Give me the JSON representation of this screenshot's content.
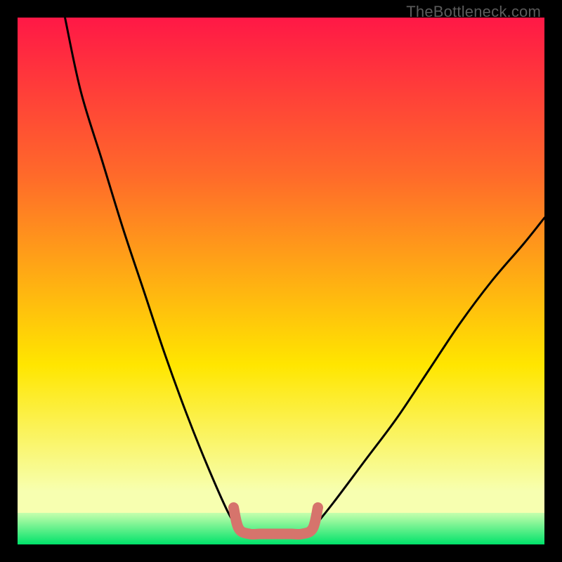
{
  "watermark": "TheBottleneck.com",
  "colors": {
    "background": "#000000",
    "gradient_top": "#ff1846",
    "gradient_mid1": "#ff6a2a",
    "gradient_mid2": "#ffe600",
    "gradient_low": "#f7ffb0",
    "green_top": "#c7ffad",
    "green_bottom": "#00e26a",
    "curve_stroke": "#000000",
    "flat_segment": "#d6746c",
    "watermark_text": "#5b5b5b"
  },
  "chart_data": {
    "type": "line",
    "title": "",
    "xlabel": "",
    "ylabel": "",
    "ylim": [
      0,
      100
    ],
    "xlim": [
      0,
      100
    ],
    "series": [
      {
        "name": "left_curve",
        "x": [
          9,
          12,
          16,
          20,
          24,
          28,
          32,
          36,
          40,
          42
        ],
        "values": [
          100,
          86,
          73,
          60,
          48,
          36,
          25,
          15,
          6,
          3
        ]
      },
      {
        "name": "flat_segment",
        "x": [
          42,
          44,
          46,
          48,
          50,
          52,
          54,
          56
        ],
        "values": [
          3,
          2,
          2,
          2,
          2,
          2,
          2,
          3
        ]
      },
      {
        "name": "right_curve",
        "x": [
          56,
          60,
          66,
          72,
          78,
          84,
          90,
          96,
          100
        ],
        "values": [
          3,
          8,
          16,
          24,
          33,
          42,
          50,
          57,
          62
        ]
      }
    ],
    "green_band": {
      "y_bottom": 0,
      "y_top": 6
    },
    "annotations": []
  }
}
